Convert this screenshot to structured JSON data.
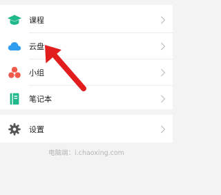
{
  "menu": {
    "items": [
      {
        "label": "课程",
        "icon": "graduation-cap-icon",
        "color": "#1fb88a"
      },
      {
        "label": "云盘",
        "icon": "cloud-icon",
        "color": "#2f9cf0"
      },
      {
        "label": "小组",
        "icon": "group-icon",
        "color": "#f05a4a"
      },
      {
        "label": "笔记本",
        "icon": "notebook-icon",
        "color": "#1fb88a"
      }
    ],
    "settings": {
      "label": "设置",
      "icon": "gear-icon",
      "color": "#555555"
    }
  },
  "footer": {
    "text": "电脑端：i.chaoxing.com"
  },
  "annotation": {
    "arrow_color": "#e11d1d",
    "points_to": "云盘"
  }
}
